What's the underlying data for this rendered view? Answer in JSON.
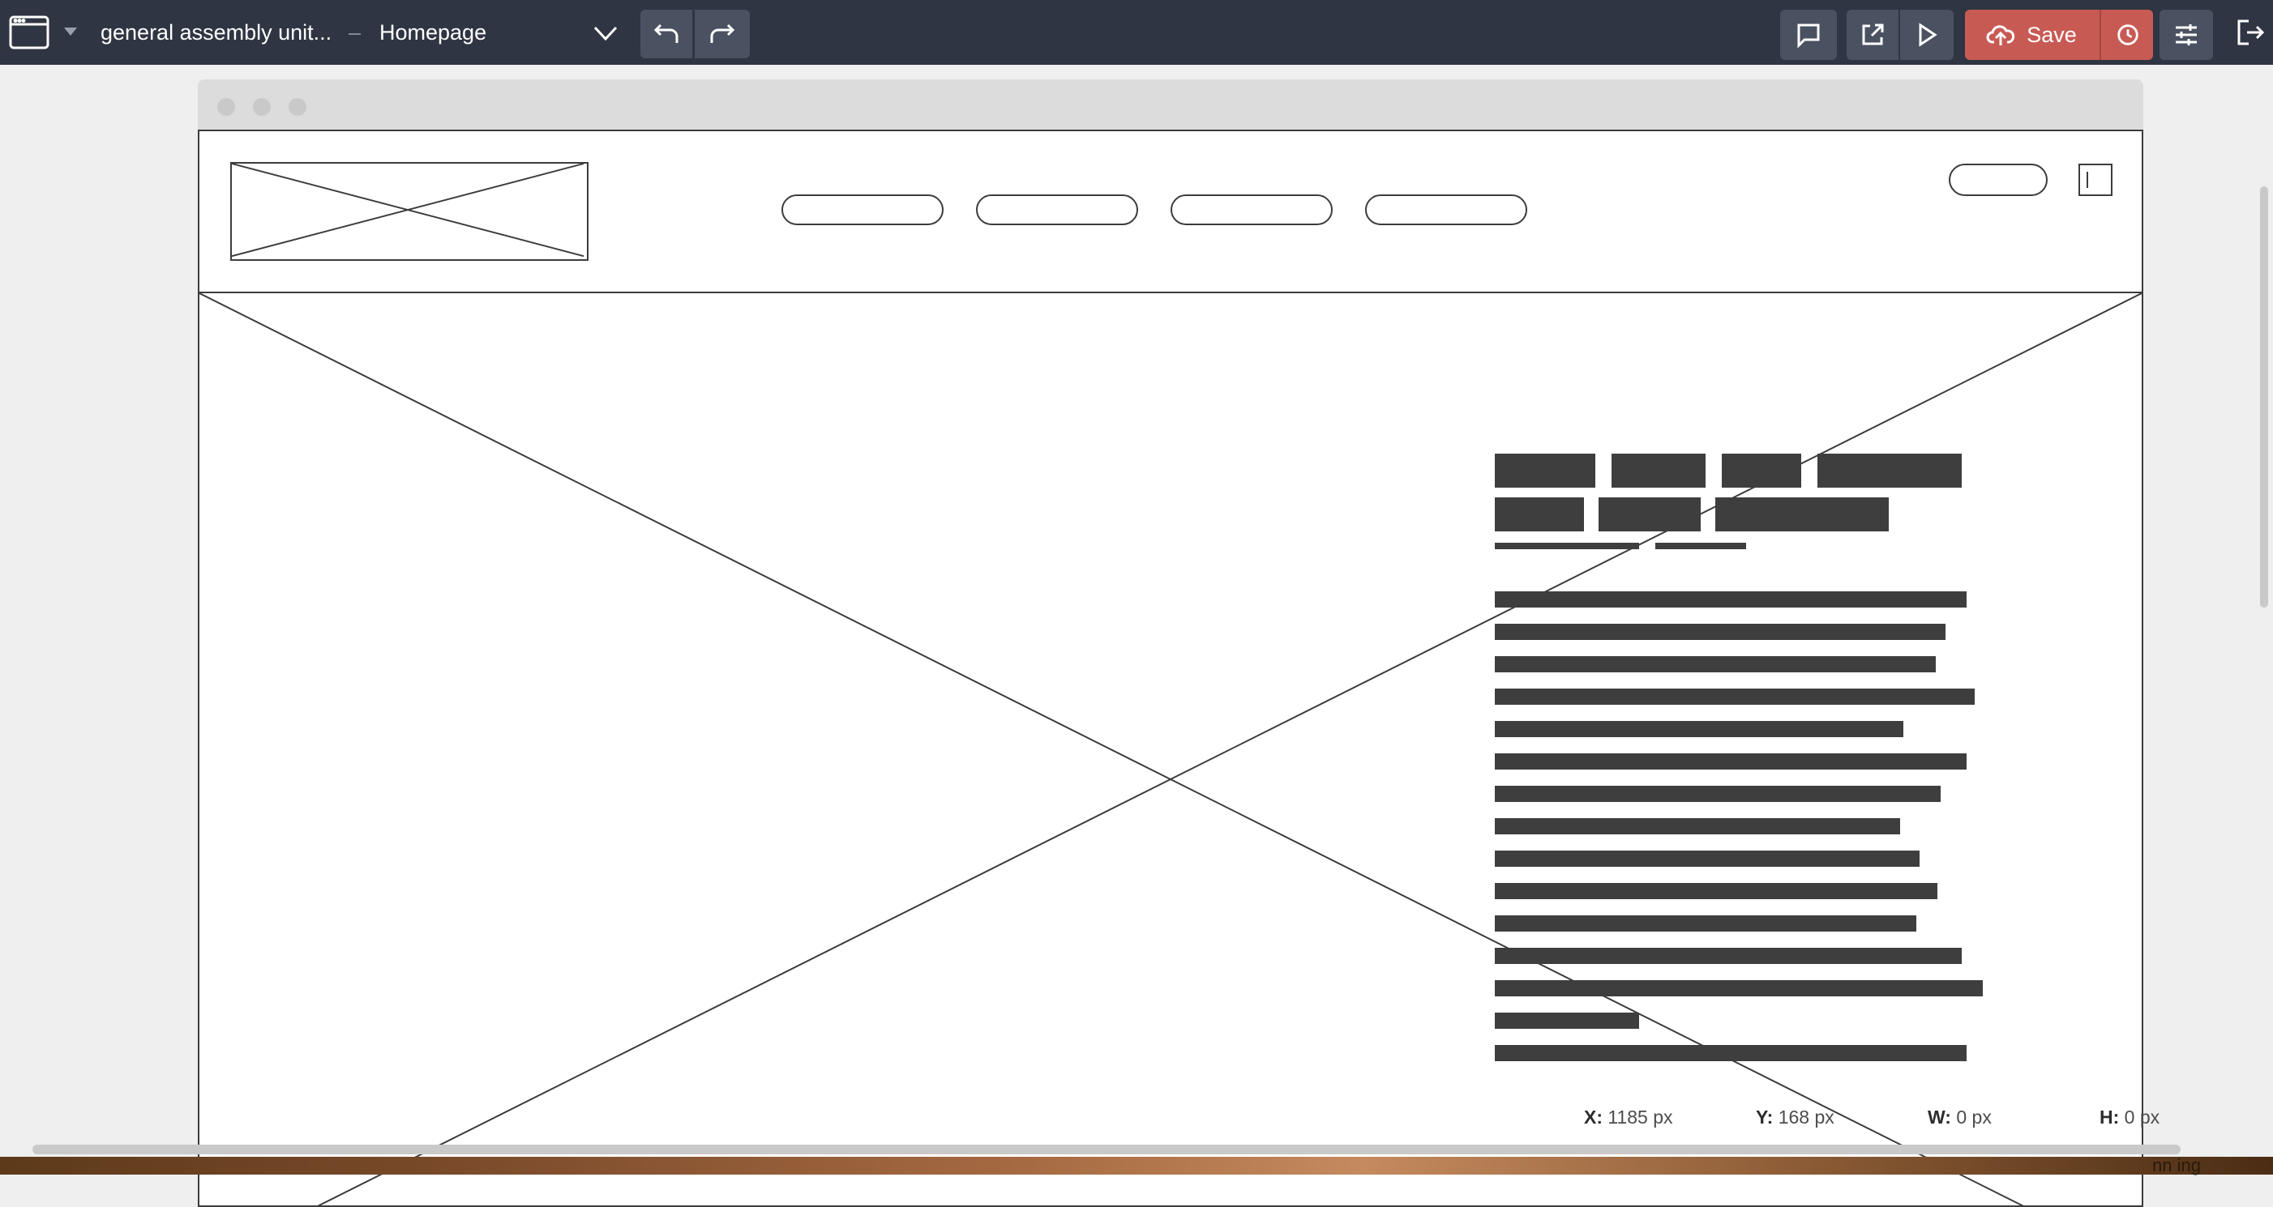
{
  "toolbar": {
    "project_name": "general assembly unit...",
    "separator": "–",
    "page_name": "Homepage",
    "save_label": "Save",
    "accent_color": "#c85a54"
  },
  "status": {
    "x_label": "X:",
    "x_value": "1185 px",
    "y_label": "Y:",
    "y_value": "168 px",
    "w_label": "W:",
    "w_value": "0 px",
    "h_label": "H:",
    "h_value": "0 px"
  },
  "taskbar": {
    "fragment_text": "nn ing"
  },
  "icons": {
    "window": "window-icon",
    "dropdown": "caret-down-icon",
    "page_menu": "chevron-down-icon",
    "undo": "undo-icon",
    "redo": "redo-icon",
    "comment": "comment-icon",
    "export": "external-link-icon",
    "preview": "play-icon",
    "upload": "cloud-upload-icon",
    "history": "history-icon",
    "settings": "sliders-icon",
    "exit": "exit-icon"
  }
}
